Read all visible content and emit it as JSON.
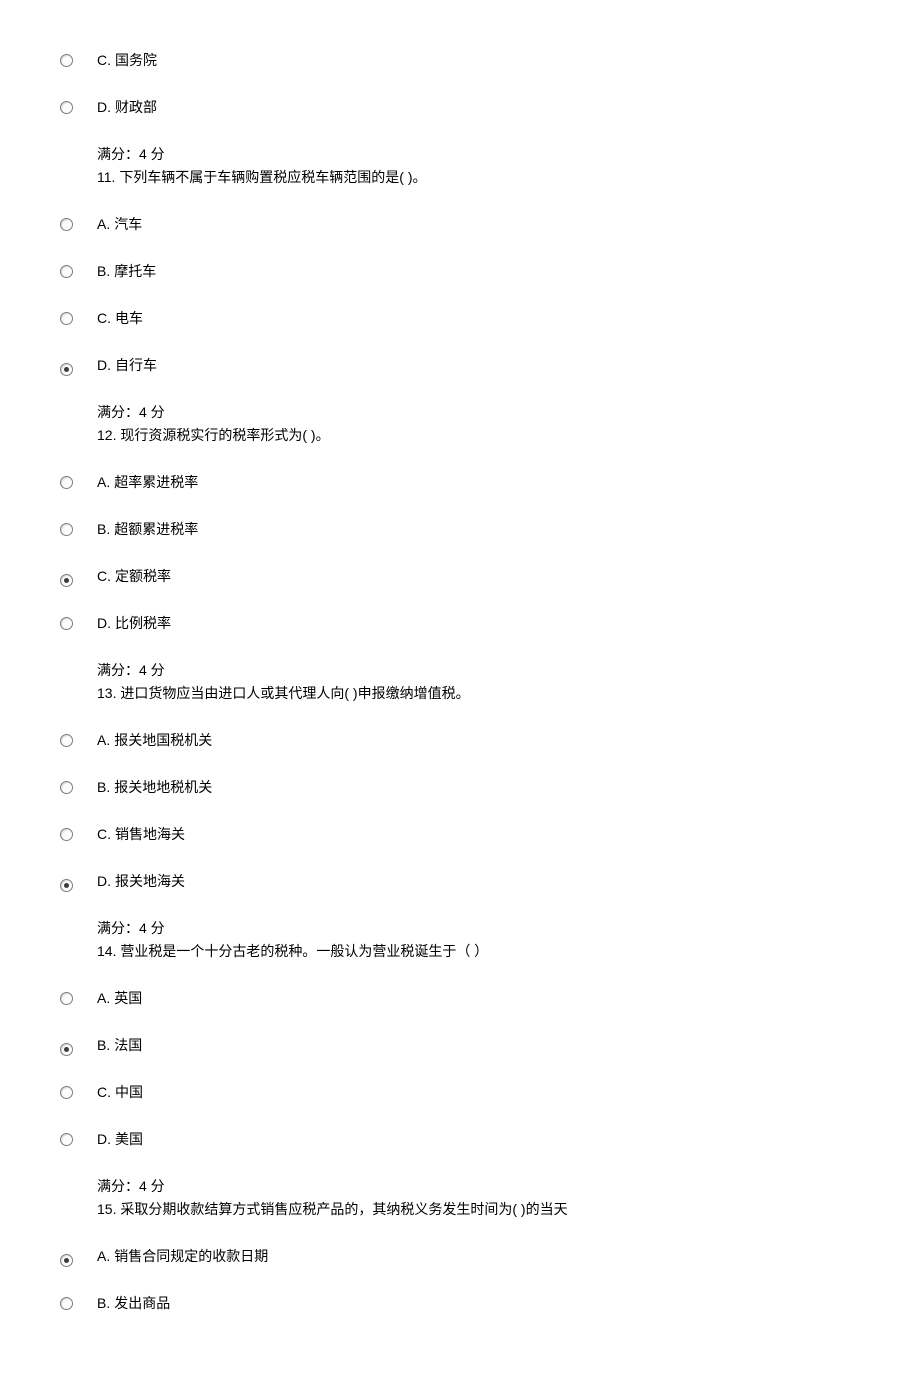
{
  "q10": {
    "optC": {
      "letter": "C.",
      "text": "国务院"
    },
    "optD": {
      "letter": "D.",
      "text": "财政部"
    },
    "score": "满分：4 分",
    "next_q": "11.  下列车辆不属于车辆购置税应税车辆范围的是( )。"
  },
  "q11": {
    "optA": {
      "letter": "A.",
      "text": "汽车"
    },
    "optB": {
      "letter": "B.",
      "text": "摩托车"
    },
    "optC": {
      "letter": "C.",
      "text": "电车"
    },
    "optD": {
      "letter": "D.",
      "text": "自行车"
    },
    "score": "满分：4 分",
    "next_q": "12.  现行资源税实行的税率形式为( )。"
  },
  "q12": {
    "optA": {
      "letter": "A.",
      "text": "超率累进税率"
    },
    "optB": {
      "letter": "B.",
      "text": "超额累进税率"
    },
    "optC": {
      "letter": "C.",
      "text": "定额税率"
    },
    "optD": {
      "letter": "D.",
      "text": "比例税率"
    },
    "score": "满分：4 分",
    "next_q": "13.  进口货物应当由进口人或其代理人向( )申报缴纳增值税。"
  },
  "q13": {
    "optA": {
      "letter": "A.",
      "text": "报关地国税机关"
    },
    "optB": {
      "letter": "B.",
      "text": "报关地地税机关"
    },
    "optC": {
      "letter": "C.",
      "text": "销售地海关"
    },
    "optD": {
      "letter": "D.",
      "text": "报关地海关"
    },
    "score": "满分：4 分",
    "next_q": "14.  营业税是一个十分古老的税种。一般认为营业税诞生于（ ）"
  },
  "q14": {
    "optA": {
      "letter": "A.",
      "text": "英国"
    },
    "optB": {
      "letter": "B.",
      "text": "法国"
    },
    "optC": {
      "letter": "C.",
      "text": "中国"
    },
    "optD": {
      "letter": "D.",
      "text": "美国"
    },
    "score": "满分：4 分",
    "next_q": "15.  采取分期收款结算方式销售应税产品的，其纳税义务发生时间为( )的当天"
  },
  "q15": {
    "optA": {
      "letter": "A.",
      "text": "销售合同规定的收款日期"
    },
    "optB": {
      "letter": "B.",
      "text": "发出商品"
    }
  }
}
